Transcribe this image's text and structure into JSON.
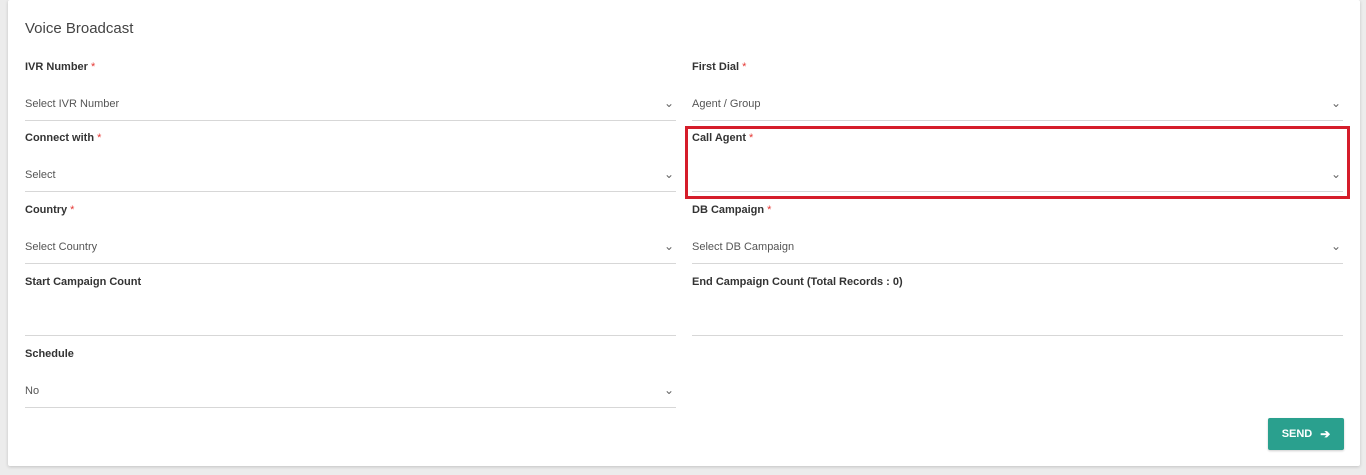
{
  "card_title": "Voice Broadcast",
  "fields": {
    "ivr_number": {
      "label": "IVR Number",
      "value": "Select IVR Number",
      "required": "*"
    },
    "first_dial": {
      "label": "First Dial",
      "value": "Agent / Group",
      "required": "*"
    },
    "connect_with": {
      "label": "Connect with",
      "value": "Select",
      "required": "*"
    },
    "call_agent": {
      "label": "Call Agent",
      "value": "",
      "required": "*"
    },
    "country": {
      "label": "Country",
      "value": "Select Country",
      "required": "*"
    },
    "db_campaign": {
      "label": "DB Campaign",
      "value": "Select DB Campaign",
      "required": "*"
    },
    "start_campaign_count": {
      "label": "Start Campaign Count",
      "value": ""
    },
    "end_campaign_count": {
      "label": "End Campaign Count (Total Records : 0)",
      "value": ""
    },
    "schedule": {
      "label": "Schedule",
      "value": "No"
    }
  },
  "send_button": {
    "label": "SEND",
    "icon": "arrow-right-icon"
  },
  "colors": {
    "accent": "#2aa08e",
    "required": "#e53935",
    "highlight": "#d51d2a"
  }
}
